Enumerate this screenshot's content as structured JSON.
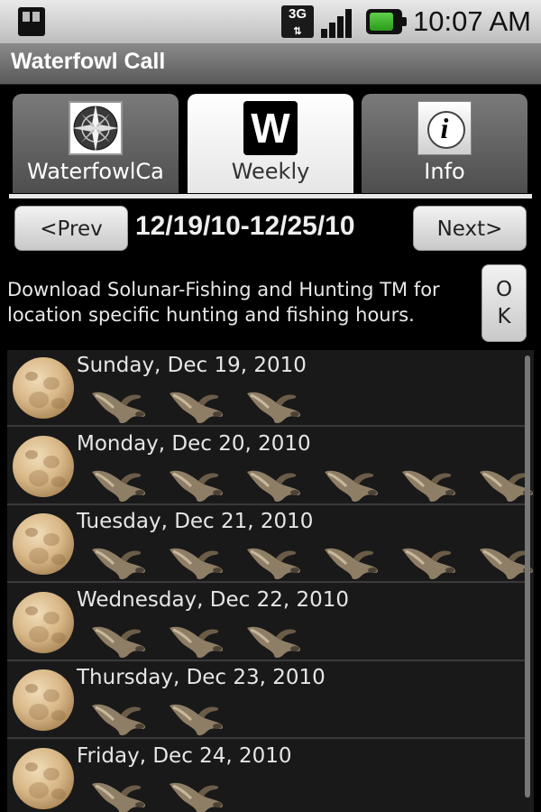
{
  "status_bar": {
    "network": "3G",
    "time": "10:07 AM"
  },
  "app": {
    "title": "Waterfowl Call"
  },
  "tabs": [
    {
      "label": "WaterfowlCa",
      "icon": "compass-icon",
      "active": false
    },
    {
      "label": "Weekly",
      "icon": "w-icon",
      "active": true
    },
    {
      "label": "Info",
      "icon": "info-icon",
      "active": false
    }
  ],
  "week_nav": {
    "prev_label": "<Prev",
    "range": "12/19/10-12/25/10",
    "next_label": "Next>"
  },
  "banner": {
    "text": "Download Solunar-Fishing and Hunting TM for location specific hunting and fishing hours.",
    "ok_label": "O K"
  },
  "days": [
    {
      "label": "Sunday, Dec 19, 2010",
      "moon": "full-moon-icon",
      "ducks": 3
    },
    {
      "label": "Monday, Dec 20, 2010",
      "moon": "full-moon-icon",
      "ducks": 6
    },
    {
      "label": "Tuesday, Dec 21, 2010",
      "moon": "full-moon-icon",
      "ducks": 6
    },
    {
      "label": "Wednesday, Dec 22, 2010",
      "moon": "full-moon-icon",
      "ducks": 3
    },
    {
      "label": "Thursday, Dec 23, 2010",
      "moon": "full-moon-icon",
      "ducks": 2
    },
    {
      "label": "Friday, Dec 24, 2010",
      "moon": "full-moon-icon",
      "ducks": 2
    }
  ]
}
